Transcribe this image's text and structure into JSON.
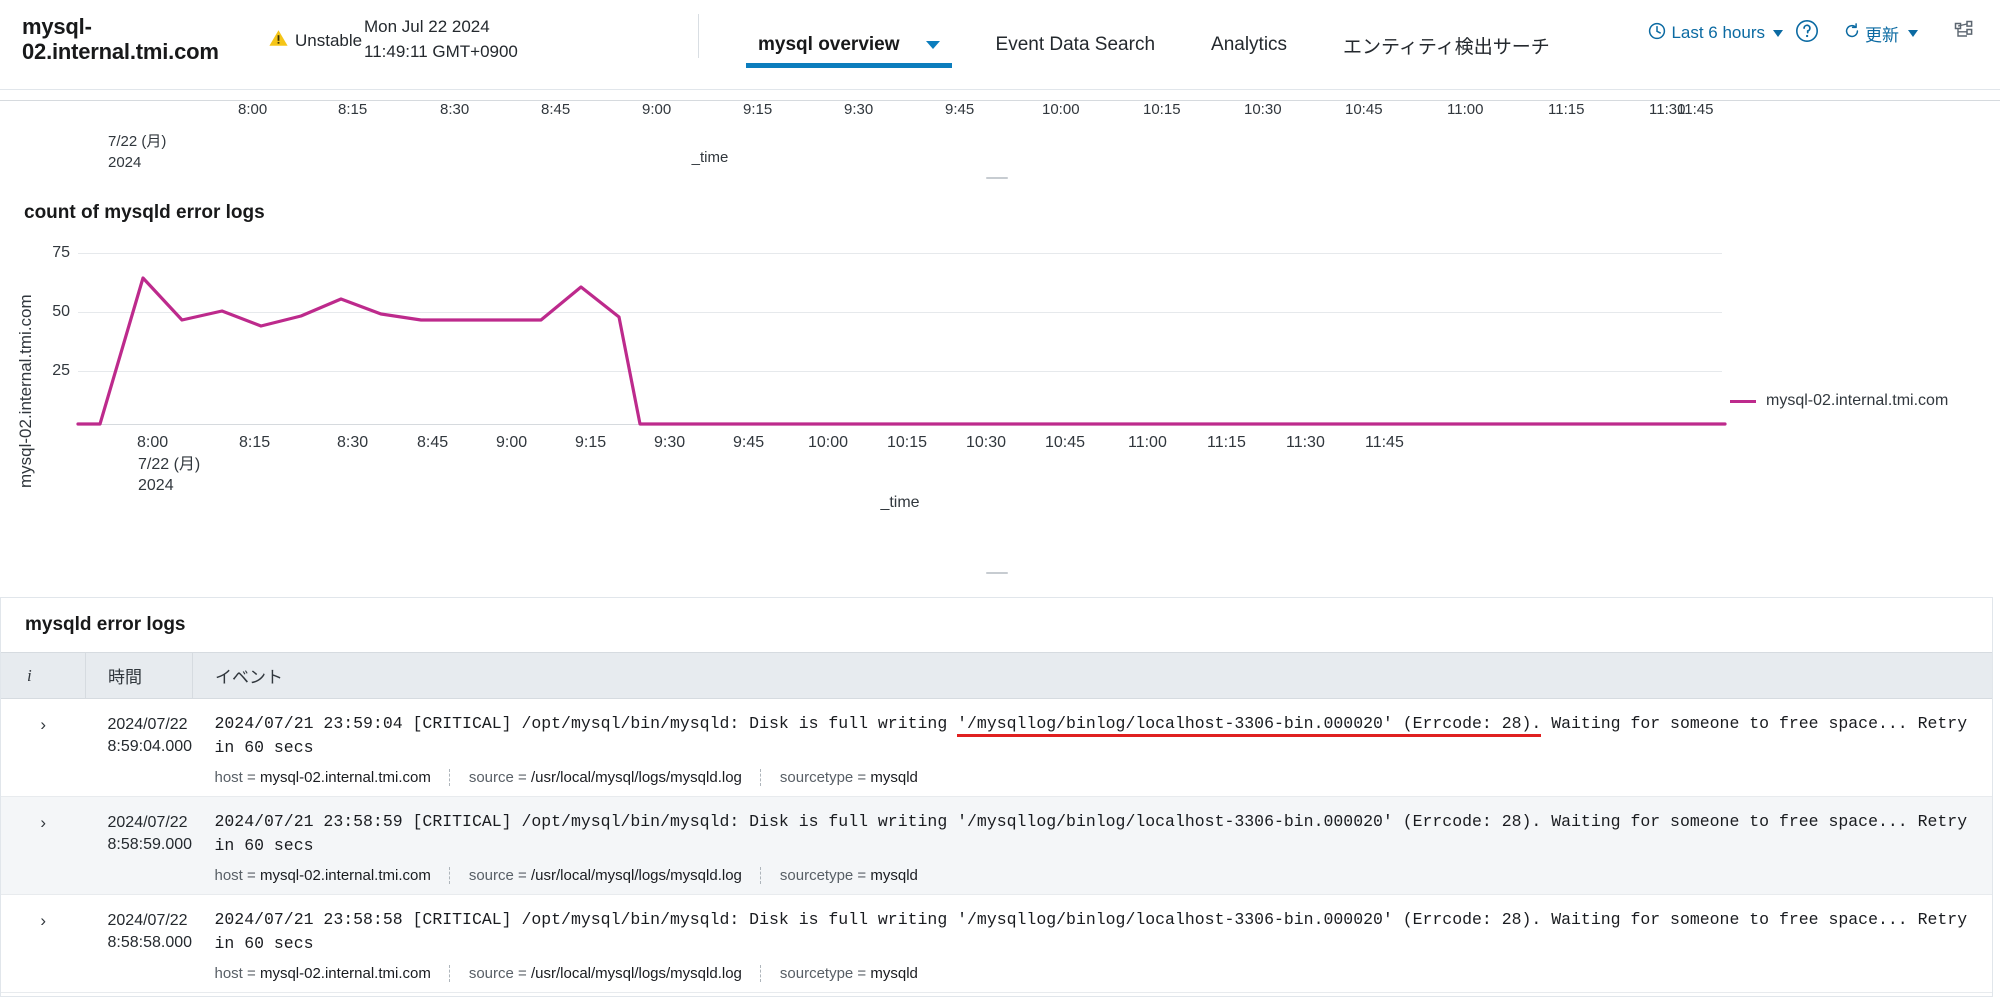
{
  "header": {
    "entity_title": "mysql-02.internal.tmi.com",
    "status_label": "Unstable",
    "timestamp": "Mon Jul 22 2024 11:49:11 GMT+0900",
    "tabs": [
      {
        "label": "mysql overview",
        "active": true,
        "has_caret": true
      },
      {
        "label": "Event Data Search",
        "active": false,
        "has_caret": false
      },
      {
        "label": "Analytics",
        "active": false,
        "has_caret": false
      },
      {
        "label": "エンティティ検出サーチ",
        "active": false,
        "has_caret": false
      }
    ],
    "time_picker": "Last 6 hours",
    "refresh_label": "更新",
    "icons": {
      "warning": "warning-triangle-icon",
      "clock": "clock-icon",
      "help": "help-circle-icon",
      "refresh": "refresh-icon",
      "tree": "tree-topology-icon"
    }
  },
  "colors": {
    "accent": "#0c7dbd",
    "link": "#0b6aa2",
    "series": "#bd2a8c",
    "warning": "#f5c518",
    "highlight_underline": "#e02020"
  },
  "top_panel": {
    "axis_title": "_time",
    "date_line1": "7/22 (月)",
    "date_line2": "2024",
    "ticks": [
      "8:00",
      "8:15",
      "8:30",
      "8:45",
      "9:00",
      "9:15",
      "9:30",
      "9:45",
      "10:00",
      "10:15",
      "10:30",
      "10:45",
      "11:00",
      "11:15",
      "11:30",
      "11:45"
    ]
  },
  "chart_panel": {
    "title": "count of mysqld error logs",
    "legend_label": "mysql-02.internal.tmi.com",
    "date_line1": "7/22 (月)",
    "date_line2": "2024"
  },
  "chart_data": {
    "type": "line",
    "title": "count of mysqld error logs",
    "xlabel": "_time",
    "ylabel": "mysql-02.internal.tmi.com",
    "ylim": [
      0,
      80
    ],
    "yticks": [
      25,
      50,
      75
    ],
    "grid": true,
    "legend_position": "right",
    "series_color": "#bd2a8c",
    "x_tick_labels": [
      "8:00",
      "8:15",
      "8:30",
      "8:45",
      "9:00",
      "9:15",
      "9:30",
      "9:45",
      "10:00",
      "10:15",
      "10:30",
      "10:45",
      "11:00",
      "11:15",
      "11:30",
      "11:45"
    ],
    "x_axis_date": "7/22 (月) 2024",
    "series": [
      {
        "name": "mysql-02.internal.tmi.com",
        "x": [
          "7:50",
          "7:55",
          "8:00",
          "8:05",
          "8:10",
          "8:15",
          "8:20",
          "8:25",
          "8:30",
          "8:35",
          "8:40",
          "8:45",
          "8:50",
          "8:55",
          "9:00",
          "9:05",
          "9:10",
          "9:15",
          "9:20",
          "9:25",
          "9:30",
          "9:35",
          "9:40",
          "9:45",
          "9:50",
          "9:55",
          "10:00",
          "10:05",
          "10:10",
          "10:15",
          "10:20",
          "10:25",
          "10:30",
          "10:35",
          "10:40",
          "10:45",
          "10:50",
          "10:55",
          "11:00",
          "11:05",
          "11:10",
          "11:15",
          "11:20",
          "11:25",
          "11:30",
          "11:35",
          "11:40",
          "11:45"
        ],
        "values": [
          0,
          0,
          61,
          44,
          48,
          41,
          46,
          42,
          52,
          45,
          42,
          42,
          42,
          57,
          45,
          0,
          0,
          0,
          0,
          0,
          0,
          0,
          0,
          0,
          0,
          0,
          0,
          0,
          0,
          0,
          0,
          0,
          0,
          0,
          0,
          0,
          0,
          0,
          0,
          0,
          0,
          0,
          0,
          0,
          0,
          0,
          0,
          0
        ]
      }
    ]
  },
  "events_panel": {
    "title": "mysqld error logs",
    "columns": [
      "i",
      "時間",
      "イベント"
    ],
    "rows": [
      {
        "time_date": "2024/07/22",
        "time_clock": "8:59:04.000",
        "event_pre": "2024/07/21 23:59:04 [CRITICAL] /opt/mysql/bin/mysqld: Disk is full writing ",
        "event_highlight": "'/mysqllog/binlog/localhost-3306-bin.000020' (Errcode: 28).",
        "event_post": " Waiting for someone to free space... Retry in 60 secs",
        "highlighted": true,
        "meta": [
          {
            "key": "host =",
            "value": "mysql-02.internal.tmi.com"
          },
          {
            "key": "source =",
            "value": "/usr/local/mysql/logs/mysqld.log"
          },
          {
            "key": "sourcetype =",
            "value": "mysqld"
          }
        ]
      },
      {
        "time_date": "2024/07/22",
        "time_clock": "8:58:59.000",
        "event_pre": "2024/07/21 23:58:59 [CRITICAL] /opt/mysql/bin/mysqld: Disk is full writing ",
        "event_highlight": "'/mysqllog/binlog/localhost-3306-bin.000020' (Errcode: 28).",
        "event_post": " Waiting for someone to free space... Retry in 60 secs",
        "highlighted": false,
        "meta": [
          {
            "key": "host =",
            "value": "mysql-02.internal.tmi.com"
          },
          {
            "key": "source =",
            "value": "/usr/local/mysql/logs/mysqld.log"
          },
          {
            "key": "sourcetype =",
            "value": "mysqld"
          }
        ]
      },
      {
        "time_date": "2024/07/22",
        "time_clock": "8:58:58.000",
        "event_pre": "2024/07/21 23:58:58 [CRITICAL] /opt/mysql/bin/mysqld: Disk is full writing ",
        "event_highlight": "'/mysqllog/binlog/localhost-3306-bin.000020' (Errcode: 28).",
        "event_post": " Waiting for someone to free space... Retry in 60 secs",
        "highlighted": false,
        "meta": [
          {
            "key": "host =",
            "value": "mysql-02.internal.tmi.com"
          },
          {
            "key": "source =",
            "value": "/usr/local/mysql/logs/mysqld.log"
          },
          {
            "key": "sourcetype =",
            "value": "mysqld"
          }
        ]
      }
    ],
    "expand_caret": "›"
  }
}
